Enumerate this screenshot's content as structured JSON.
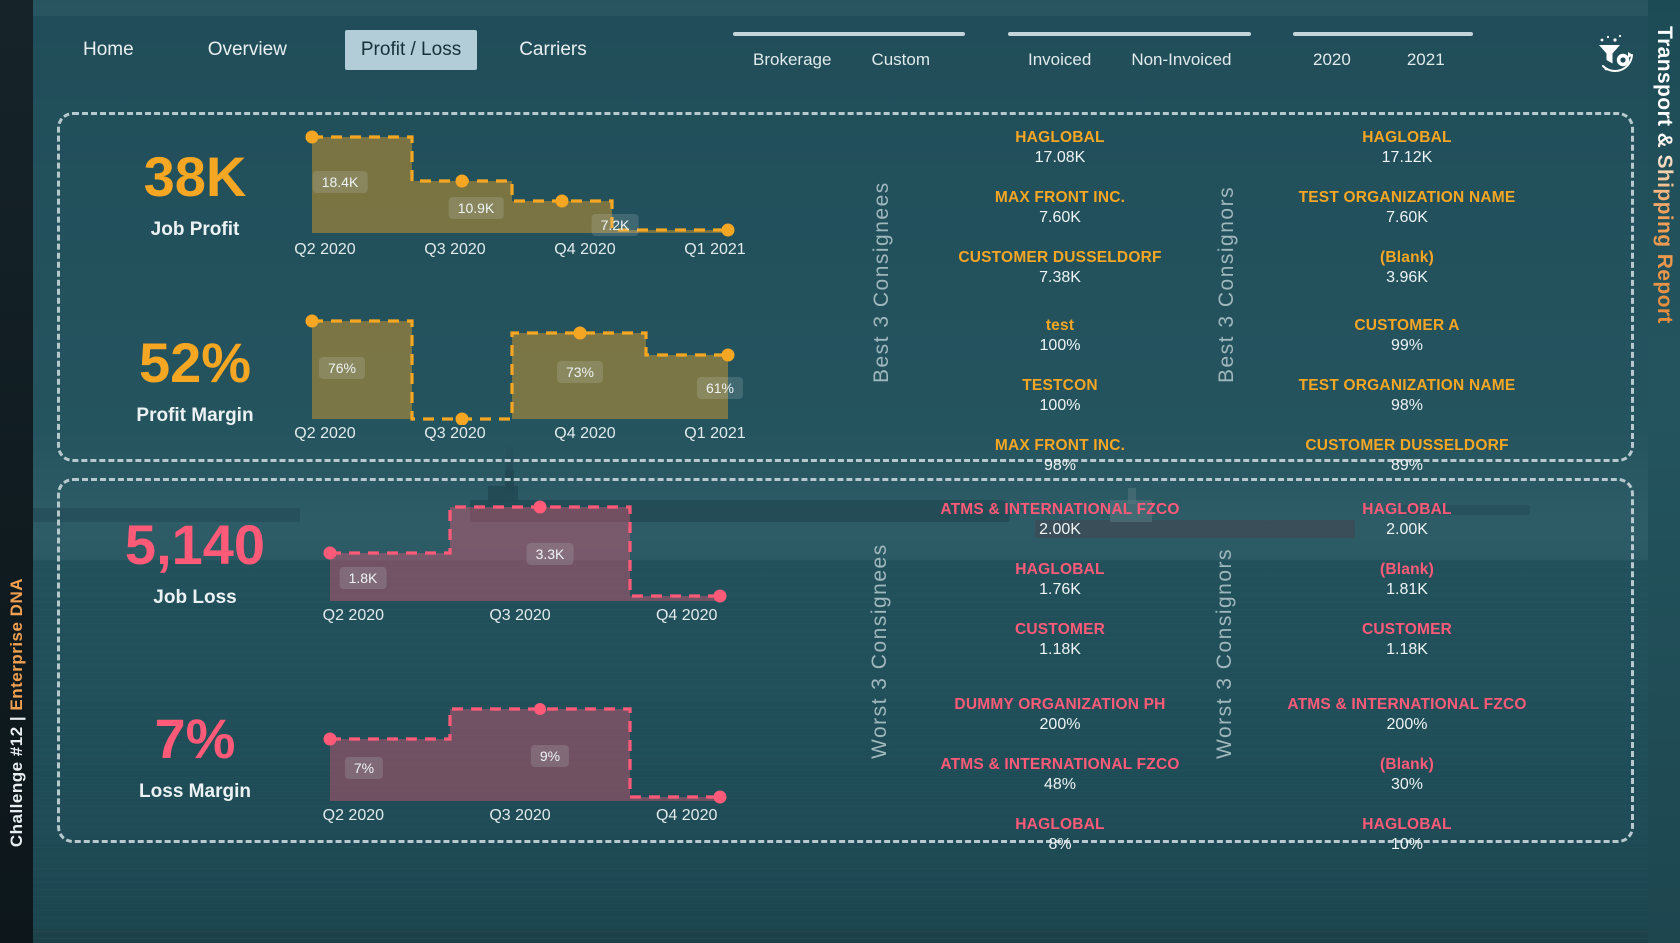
{
  "theme": {
    "gold": "#f5a623",
    "rose": "#ff5a78",
    "panel_border": "#b7c9cf",
    "text": "#e9eff1"
  },
  "rail": {
    "challenge": "Challenge #12  |  ",
    "brand": "Enterprise DNA"
  },
  "report_title": "Transport & Shipping Report",
  "nav": {
    "items": [
      {
        "label": "Home",
        "active": false
      },
      {
        "label": "Overview",
        "active": false
      },
      {
        "label": "Profit / Loss",
        "active": true
      },
      {
        "label": "Carriers",
        "active": false
      }
    ]
  },
  "filters": [
    {
      "name": "service-type",
      "options": [
        "Brokerage",
        "Custom"
      ]
    },
    {
      "name": "invoice-status",
      "options": [
        "Invoiced",
        "Non-Invoiced"
      ]
    },
    {
      "name": "year",
      "options": [
        "2020",
        "2021"
      ]
    }
  ],
  "reset_icon": "filter-reset-icon",
  "kpis": {
    "job_profit": {
      "value": "38K",
      "label": "Job Profit"
    },
    "profit_margin": {
      "value": "52%",
      "label": "Profit Margin"
    },
    "job_loss": {
      "value": "5,140",
      "label": "Job Loss"
    },
    "loss_margin": {
      "value": "7%",
      "label": "Loss Margin"
    }
  },
  "chart_data": [
    {
      "id": "job-profit",
      "type": "area",
      "title": "Job Profit",
      "categories": [
        "Q2 2020",
        "Q3 2020",
        "Q4 2020",
        "Q1 2021"
      ],
      "values": [
        18400,
        10900,
        7200,
        100
      ],
      "labels": [
        "18.4K",
        "10.9K",
        "7.2K",
        ""
      ],
      "color": "#f5a623",
      "ylim": [
        0,
        19500
      ],
      "grid": false,
      "xlabel": "",
      "ylabel": ""
    },
    {
      "id": "profit-margin",
      "type": "area",
      "title": "Profit Margin",
      "categories": [
        "Q2 2020",
        "Q3 2020",
        "Q4 2020",
        "Q1 2021"
      ],
      "values": [
        76,
        0,
        73,
        61
      ],
      "labels": [
        "76%",
        "",
        "73%",
        "61%"
      ],
      "color": "#f5a623",
      "ylim": [
        0,
        80
      ],
      "grid": false,
      "xlabel": "",
      "ylabel": ""
    },
    {
      "id": "job-loss",
      "type": "area",
      "title": "Job Loss",
      "categories": [
        "Q2 2020",
        "Q3 2020",
        "Q4 2020"
      ],
      "values": [
        1800,
        3300,
        60
      ],
      "labels": [
        "1.8K",
        "3.3K",
        ""
      ],
      "color": "#ff5a78",
      "ylim": [
        0,
        3600
      ],
      "grid": false,
      "xlabel": "",
      "ylabel": ""
    },
    {
      "id": "loss-margin",
      "type": "area",
      "title": "Loss Margin",
      "categories": [
        "Q2 2020",
        "Q3 2020",
        "Q4 2020"
      ],
      "values": [
        7,
        9,
        0.3
      ],
      "labels": [
        "7%",
        "9%",
        ""
      ],
      "color": "#ff5a78",
      "ylim": [
        0,
        10
      ],
      "grid": false,
      "xlabel": "",
      "ylabel": ""
    }
  ],
  "rankings": {
    "best_consignees_label": "Best 3 Consignees",
    "best_consignors_label": "Best 3 Consignors",
    "worst_consignees_label": "Worst 3 Consignees",
    "worst_consignors_label": "Worst 3 Consignors",
    "best_consignees_profit": [
      {
        "name": "HAGLOBAL",
        "value": "17.08K"
      },
      {
        "name": "MAX FRONT INC.",
        "value": "7.60K"
      },
      {
        "name": "CUSTOMER DUSSELDORF",
        "value": "7.38K"
      }
    ],
    "best_consignors_profit": [
      {
        "name": "HAGLOBAL",
        "value": "17.12K"
      },
      {
        "name": "TEST ORGANIZATION NAME",
        "value": "7.60K"
      },
      {
        "name": "(Blank)",
        "value": "3.96K"
      }
    ],
    "best_consignees_margin": [
      {
        "name": "test",
        "value": "100%"
      },
      {
        "name": "TESTCON",
        "value": "100%"
      },
      {
        "name": "MAX FRONT INC.",
        "value": "98%"
      }
    ],
    "best_consignors_margin": [
      {
        "name": "CUSTOMER A",
        "value": "99%"
      },
      {
        "name": "TEST ORGANIZATION NAME",
        "value": "98%"
      },
      {
        "name": "CUSTOMER DUSSELDORF",
        "value": "89%"
      }
    ],
    "worst_consignees_loss": [
      {
        "name": "ATMS & INTERNATIONAL FZCO",
        "value": "2.00K"
      },
      {
        "name": "HAGLOBAL",
        "value": "1.76K"
      },
      {
        "name": "CUSTOMER",
        "value": "1.18K"
      }
    ],
    "worst_consignors_loss": [
      {
        "name": "HAGLOBAL",
        "value": "2.00K"
      },
      {
        "name": "(Blank)",
        "value": "1.81K"
      },
      {
        "name": "CUSTOMER",
        "value": "1.18K"
      }
    ],
    "worst_consignees_margin": [
      {
        "name": "DUMMY ORGANIZATION PH",
        "value": "200%"
      },
      {
        "name": "ATMS & INTERNATIONAL FZCO",
        "value": "48%"
      },
      {
        "name": "HAGLOBAL",
        "value": "8%"
      }
    ],
    "worst_consignors_margin": [
      {
        "name": "ATMS & INTERNATIONAL FZCO",
        "value": "200%"
      },
      {
        "name": "(Blank)",
        "value": "30%"
      },
      {
        "name": "HAGLOBAL",
        "value": "10%"
      }
    ]
  }
}
